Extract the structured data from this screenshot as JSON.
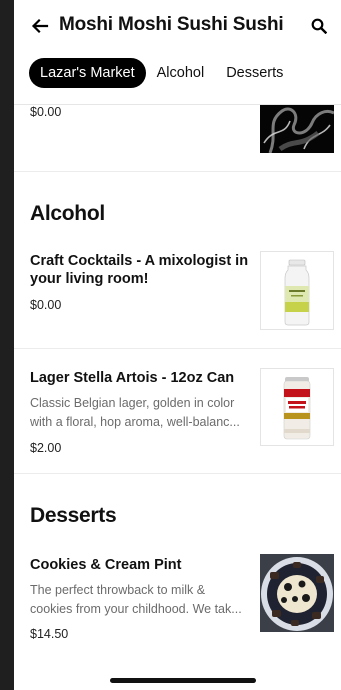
{
  "header": {
    "store_name": "Moshi Moshi Sushi Sushi",
    "tabs": [
      {
        "label": "Lazar's Market",
        "active": true
      },
      {
        "label": "Alcohol",
        "active": false
      },
      {
        "label": "Desserts",
        "active": false
      }
    ]
  },
  "partial_item": {
    "price": "$0.00"
  },
  "sections": [
    {
      "title": "Alcohol",
      "items": [
        {
          "name": "Craft Cocktails - A mixologist in your living room!",
          "description": "",
          "price": "$0.00",
          "image": "cocktail-bottle"
        },
        {
          "name": "Lager Stella Artois - 12oz Can",
          "description": "Classic Belgian lager, golden in color with a floral, hop aroma, well-balanc...",
          "price": "$2.00",
          "image": "beer-can"
        }
      ]
    },
    {
      "title": "Desserts",
      "items": [
        {
          "name": "Cookies & Cream Pint",
          "description": "The perfect throwback to milk & cookies from your childhood. We tak...",
          "price": "$14.50",
          "image": "ice-cream-bowl"
        }
      ]
    }
  ],
  "colors": {
    "accent": "#000000",
    "background": "#ffffff",
    "muted_text": "#6b6b6b"
  }
}
